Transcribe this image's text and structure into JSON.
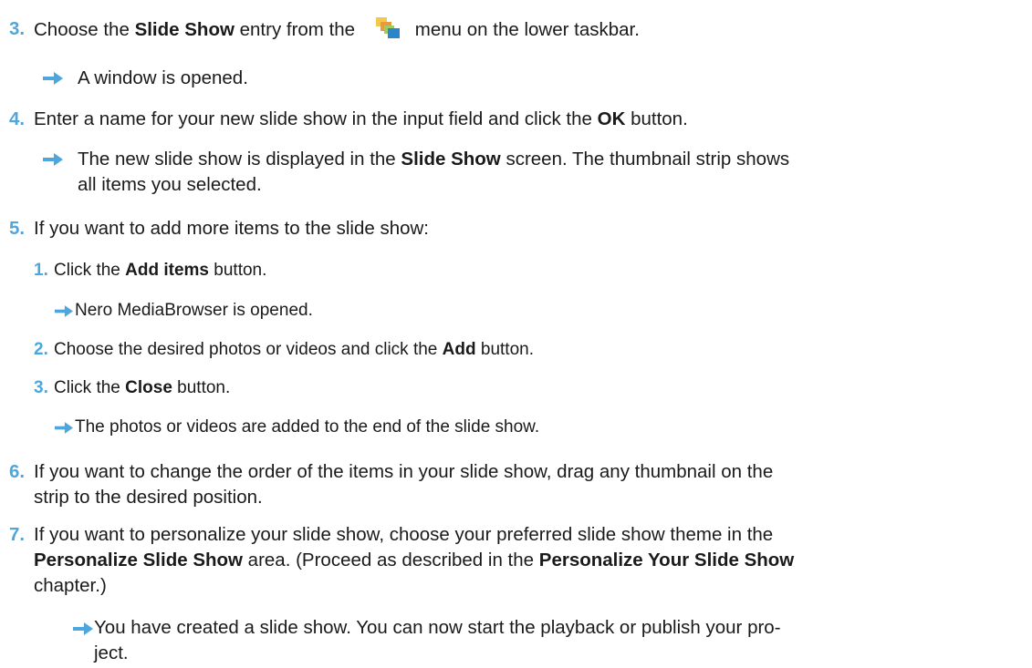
{
  "steps": {
    "s3": {
      "num": "3.",
      "a": "Choose the ",
      "b1": "Slide Show",
      "c": " entry from the ",
      "d": "menu on the lower taskbar."
    },
    "r3": {
      "text": "A window is opened."
    },
    "s4": {
      "num": "4.",
      "a": "Enter a name for your new slide show in the input field and click the ",
      "b1": "OK",
      "c": " button."
    },
    "r4": {
      "a": "The new slide show is displayed in the ",
      "b1": "Slide Show",
      "c": " screen. The thumbnail strip shows",
      "line2": "all items you selected."
    },
    "s5": {
      "num": "5.",
      "text": "If you want to add more items to the slide show:"
    },
    "s5_1": {
      "num": "1.",
      "a": "Click the ",
      "b1": "Add items",
      "c": " button."
    },
    "r5_1": {
      "text": "Nero MediaBrowser is opened."
    },
    "s5_2": {
      "num": "2.",
      "a": "Choose the desired photos or videos and click the ",
      "b1": "Add",
      "c": " button."
    },
    "s5_3": {
      "num": "3.",
      "a": "Click the ",
      "b1": "Close",
      "c": " button."
    },
    "r5_3": {
      "text": "The photos or videos are added to the end of the slide show."
    },
    "s6": {
      "num": "6.",
      "line1": "If you want to change the order of the items in your slide show, drag any thumbnail on the",
      "line2": "strip to the desired position."
    },
    "s7": {
      "num": "7.",
      "line1": "If you want to personalize your slide show, choose your preferred slide show theme in the",
      "b1": "Personalize Slide Show",
      "m1": " area. (Proceed as described in the ",
      "b2": "Personalize Your Slide Show",
      "line3": "chapter.)"
    },
    "r7": {
      "line1": "You have created a slide show. You can now start the playback or publish your pro-",
      "line2": "ject."
    }
  },
  "colors": {
    "accent": "#4da6dc",
    "text": "#1a1a1a"
  },
  "icons": {
    "arrow": "arrow-right-icon",
    "menu": "slideshow-menu-icon"
  }
}
